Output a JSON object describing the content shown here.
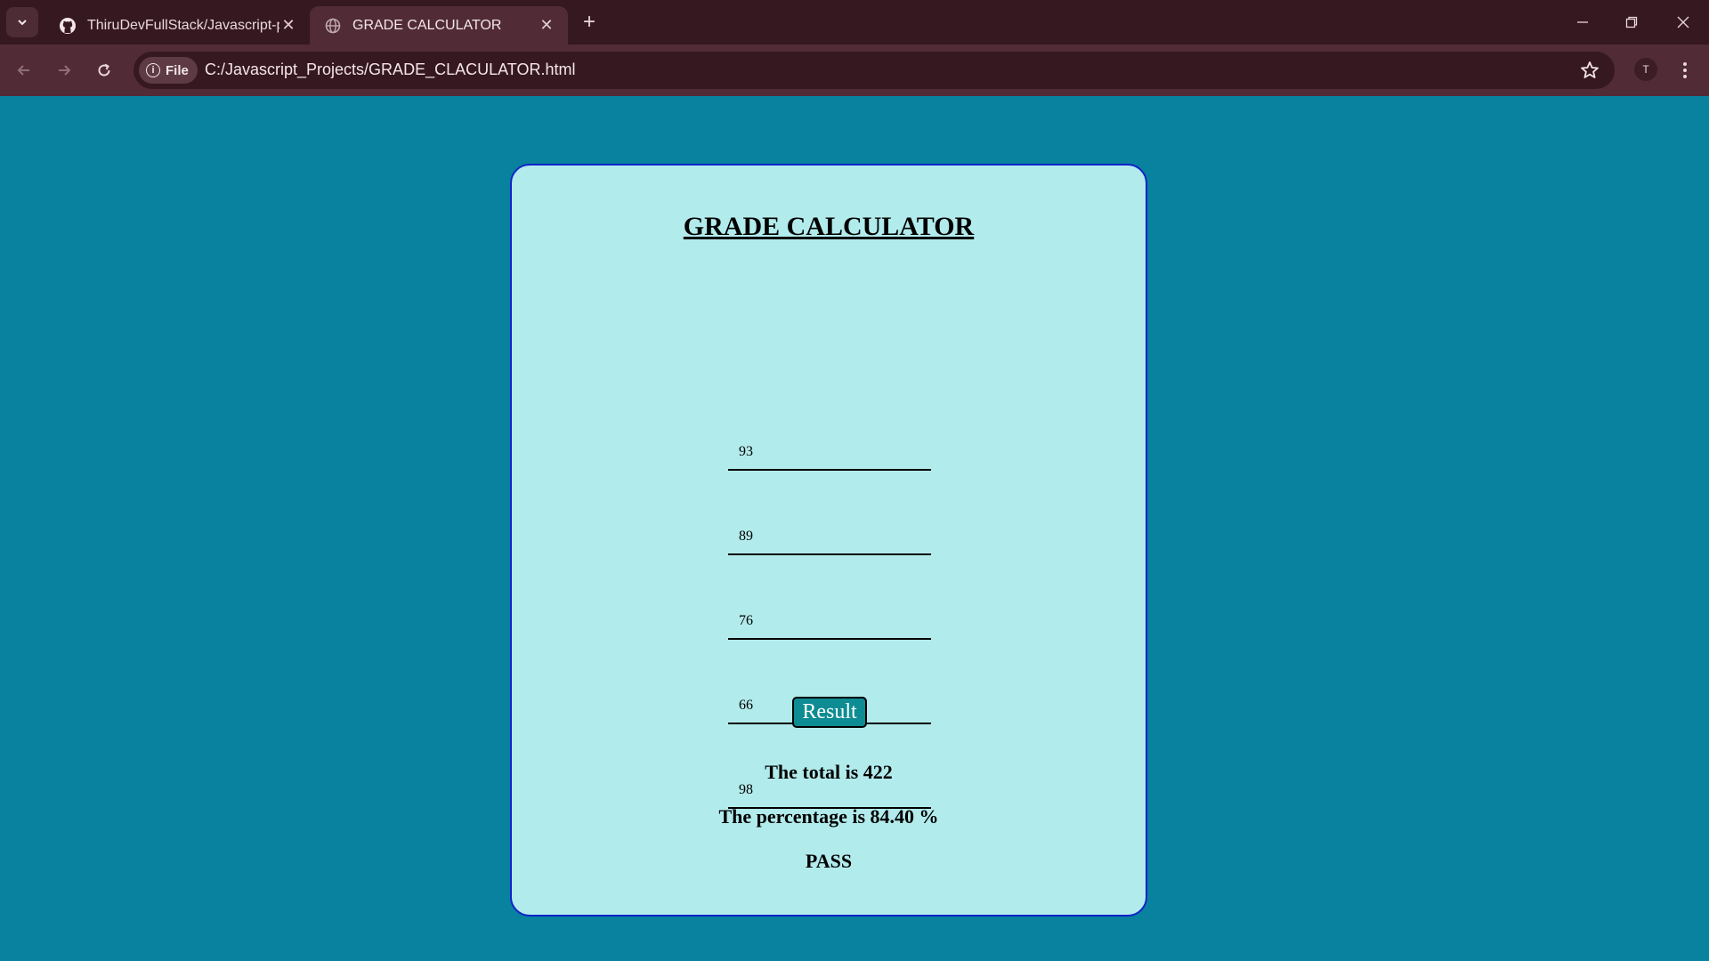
{
  "browser": {
    "tabs": [
      {
        "title": "ThiruDevFullStack/Javascript-pr",
        "icon": "github-icon",
        "active": false
      },
      {
        "title": "GRADE CALCULATOR",
        "icon": "globe-icon",
        "active": true
      }
    ],
    "address": {
      "scheme_label": "File",
      "url": "C:/Javascript_Projects/GRADE_CLACULATOR.html"
    },
    "profile_initial": "T"
  },
  "page": {
    "title": "GRADE CALCULATOR",
    "marks": [
      "93",
      "89",
      "76",
      "66",
      "98"
    ],
    "button_label": "Result",
    "total_text": "The total is 422",
    "percentage_text": "The percentage is 84.40 %",
    "status_text": "PASS"
  },
  "colors": {
    "page_bg": "#08829f",
    "card_bg": "#b2ebec",
    "card_border": "#1023c8",
    "button_bg": "#0e8c93",
    "chrome_dark": "#361820",
    "chrome_toolbar": "#512b36"
  }
}
